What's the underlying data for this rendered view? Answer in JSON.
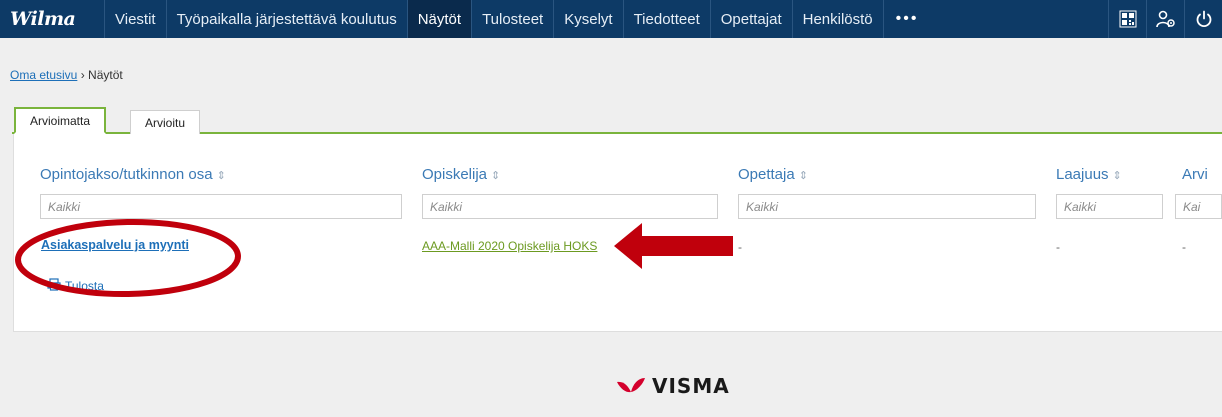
{
  "nav": {
    "logo": "Wilma",
    "items": [
      {
        "label": "Viestit",
        "active": false
      },
      {
        "label": "Työpaikalla järjestettävä koulutus",
        "active": false
      },
      {
        "label": "Näytöt",
        "active": true
      },
      {
        "label": "Tulosteet",
        "active": false
      },
      {
        "label": "Kyselyt",
        "active": false
      },
      {
        "label": "Tiedotteet",
        "active": false
      },
      {
        "label": "Opettajat",
        "active": false
      },
      {
        "label": "Henkilöstö",
        "active": false
      }
    ],
    "more": "•••",
    "icons": [
      "qr-code-icon",
      "user-settings-icon",
      "power-icon"
    ]
  },
  "breadcrumb": {
    "home": "Oma etusivu",
    "separator": "›",
    "current": "Näytöt"
  },
  "tabs": [
    {
      "label": "Arvioimatta",
      "active": true
    },
    {
      "label": "Arvioitu",
      "active": false
    }
  ],
  "table": {
    "columns": [
      {
        "label": "Opintojakso/tutkinnon osa",
        "sort": "⇕",
        "placeholder": "Kaikki"
      },
      {
        "label": "Opiskelija",
        "sort": "⇕",
        "placeholder": "Kaikki"
      },
      {
        "label": "Opettaja",
        "sort": "⇕",
        "placeholder": "Kaikki"
      },
      {
        "label": "Laajuus",
        "sort": "⇕",
        "placeholder": "Kaikki"
      },
      {
        "label": "Arvi",
        "sort": "",
        "placeholder": "Kai"
      }
    ],
    "rows": [
      {
        "course": "Asiakaspalvelu ja myynti",
        "student": "AAA-Malli 2020 Opiskelija HOKS",
        "teacher": "-",
        "scope": "-",
        "grade": "-"
      }
    ]
  },
  "print_label": "Tulosta",
  "footer": {
    "brand": "VISMA"
  },
  "colors": {
    "nav_bg": "#0d3a66",
    "accent_green": "#7ab43c",
    "link_blue": "#1d6fb8",
    "annotation_red": "#c0000c"
  }
}
